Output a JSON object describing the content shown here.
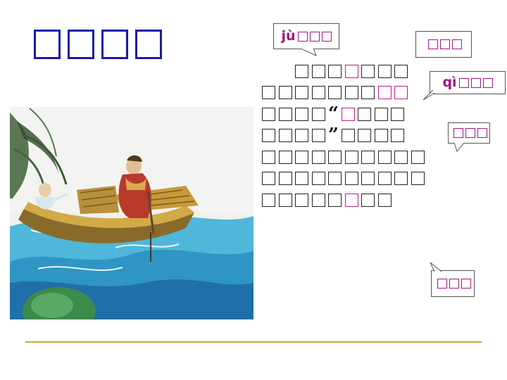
{
  "slide": {
    "title": {
      "glyph_count": 4,
      "color": "#1a1aa8"
    },
    "passage": {
      "glyph_color": "#222222",
      "highlight_color": "#c2188a",
      "lines": [
        {
          "indent": true,
          "cells": [
            "g",
            "g",
            "g",
            "h",
            "g",
            "g",
            "g"
          ]
        },
        {
          "indent": false,
          "cells": [
            "g",
            "g",
            "g",
            "g",
            "g",
            "g",
            "g",
            "h",
            "h"
          ]
        },
        {
          "indent": false,
          "cells": [
            "g",
            "g",
            "g",
            "g",
            "q",
            "h",
            "g",
            "g",
            "g"
          ]
        },
        {
          "indent": false,
          "cells": [
            "g",
            "g",
            "g",
            "g",
            "Q",
            "g",
            "g",
            "g",
            "g"
          ]
        },
        {
          "indent": false,
          "cells": [
            "g",
            "g",
            "g",
            "g",
            "g",
            "g",
            "g",
            "g",
            "g",
            "g"
          ]
        },
        {
          "indent": false,
          "cells": [
            "g",
            "g",
            "g",
            "g",
            "g",
            "g",
            "g",
            "g",
            "g",
            "g"
          ]
        },
        {
          "indent": false,
          "cells": [
            "g",
            "g",
            "g",
            "g",
            "g",
            "h",
            "g",
            "g"
          ]
        }
      ],
      "open_quote": "“",
      "close_quote": "”"
    },
    "callouts": [
      {
        "id": "callout-ju",
        "pinyin": "jù",
        "glyph_count": 3
      },
      {
        "id": "callout-1",
        "pinyin": "",
        "glyph_count": 3
      },
      {
        "id": "callout-qi",
        "pinyin": "qì",
        "glyph_count": 3
      },
      {
        "id": "callout-2",
        "pinyin": "",
        "glyph_count": 3
      },
      {
        "id": "callout-3",
        "pinyin": "",
        "glyph_count": 3
      }
    ],
    "accent_color": "#a0177e",
    "divider_color": "#c8a43a"
  }
}
